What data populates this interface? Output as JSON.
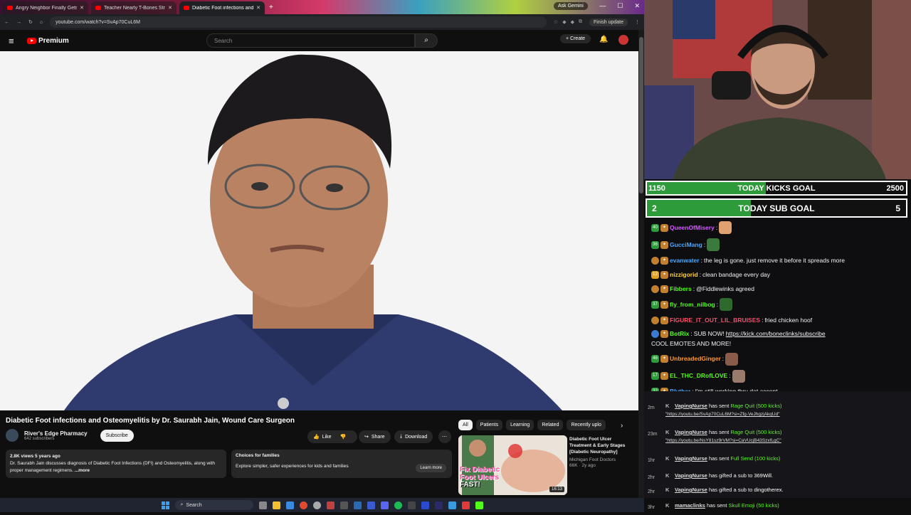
{
  "browser": {
    "tabs": [
      {
        "title": "Angry Neighbor Finally Gets W"
      },
      {
        "title": "Teacher Nearly T-Bones Strang"
      },
      {
        "title": "Diabetic Foot infections and"
      }
    ],
    "ask_gemini": "Ask Gemini",
    "url": "youtube.com/watch?v=SvAp70CuL6M",
    "finish_update": "Finish update"
  },
  "youtube": {
    "logo": "Premium",
    "search_placeholder": "Search",
    "create": "Create",
    "video_title": "Diabetic Foot infections and Osteomyelitis by Dr. Saurabh Jain, Wound Care Surgeon",
    "channel_name": "River's Edge Pharmacy",
    "subscribers": "642 subscribers",
    "subscribe": "Subscribe",
    "like": "Like",
    "share": "Share",
    "download": "Download",
    "desc_meta": "2.8K views  5 years ago",
    "desc_text": "Dr. Saurabh Jain discusses diagnosis of Diabetic Foot Infections (DFI) and Osteomyelitis, along with proper management regimens.",
    "desc_more": "...more",
    "choices_title": "Choices for families",
    "choices_text": "Explore simpler, safer experiences for kids and families",
    "learn_more": "Learn more",
    "chips": [
      "All",
      "Patients",
      "Learning",
      "Related",
      "Recently uplo"
    ],
    "rec": {
      "title": "Diabetic Foot Ulcer Treatment & Early Stages [Diabetic Neuropathy]",
      "channel": "Michigan Foot Doctors",
      "meta": "66K · 2y ago",
      "duration": "16:13",
      "thumb_text_1": "Fix Diabetic",
      "thumb_text_2": "Foot Ulcers",
      "thumb_text_3": "FAST!"
    }
  },
  "stream": {
    "kicks_goal": {
      "current": "1150",
      "label": "TODAY KICKS GOAL",
      "target": "2500",
      "progress": 0.46
    },
    "sub_goal": {
      "current": "2",
      "label": "TODAY SUB GOAL",
      "target": "5",
      "progress": 0.4
    },
    "chat": [
      {
        "badge": "40",
        "badge_color": "#2e9b3a",
        "user": "QueenOfMisery",
        "color": "#d45aff",
        "text": "",
        "emote": "#e0a070"
      },
      {
        "badge": "36",
        "badge_color": "#2e9b3a",
        "user": "GucciMang",
        "color": "#4aa8ff",
        "text": "",
        "emote": "#3a7a3a"
      },
      {
        "badge": "",
        "badge_color": "#c08030",
        "user": "evanwater",
        "color": "#4aa8ff",
        "text": "the leg is gone. just remove it before it spreads more",
        "emote": ""
      },
      {
        "badge": "12",
        "badge_color": "#e0a020",
        "user": "nizzigorid",
        "color": "#ffd030",
        "text": "clean bandage every day",
        "emote": ""
      },
      {
        "badge": "",
        "badge_color": "#c08030",
        "user": "Fibbers",
        "color": "#53fc18",
        "text": "@Fiddlewinks agreed",
        "emote": ""
      },
      {
        "badge": "37",
        "badge_color": "#2e9b3a",
        "user": "fly_from_nilbog",
        "color": "#53fc18",
        "text": "",
        "emote": "#2e6a2e"
      },
      {
        "badge": "",
        "badge_color": "#c08030",
        "user": "FIGURE_IT_OUT_LIL_BRUISES",
        "color": "#ff4a6a",
        "text": "fried chicken hoof",
        "emote": ""
      },
      {
        "badge": "",
        "badge_color": "#3a7ad0",
        "user": "BotRix",
        "color": "#53fc18",
        "text": "SUB NOW! ",
        "link": "https://kick.com/boneclinks/subscribe",
        "text2": " COOL EMOTES AND MORE!",
        "emote": ""
      },
      {
        "badge": "46",
        "badge_color": "#2e9b3a",
        "user": "UnbreadedGinger",
        "color": "#ff9a30",
        "text": "",
        "emote": "#8a5a4a"
      },
      {
        "badge": "17",
        "badge_color": "#2e9b3a",
        "user": "EL_THC_DRofLOVE",
        "color": "#53fc18",
        "text": "",
        "emote": "#9a7a6a"
      },
      {
        "badge": "32",
        "badge_color": "#2e9b3a",
        "user": "Blyther",
        "color": "#4aa8ff",
        "text": "I'm still working thru dat accent",
        "emote": ""
      }
    ],
    "alerts": [
      {
        "age": "2m",
        "user": "VapingNurse",
        "mid": "has sent",
        "item": "Rage Quit (500 kicks)",
        "sub": "\"https://youtu.be/SvAp70CuL6M?si=Zfg-VeJhgzjAkqUd\""
      },
      {
        "age": "23m",
        "user": "VapingNurse",
        "mid": "has sent",
        "item": "Rage Quit (500 kicks)",
        "sub": "\"https://youtu.be/NsY81sz9rVM?si=CaVUcjB43SzxfLgC\""
      },
      {
        "age": "1hr",
        "user": "VapingNurse",
        "mid": "has sent",
        "item": "Full Send (100 kicks)",
        "sub": ""
      },
      {
        "age": "2hr",
        "user": "VapingNurse",
        "mid": "has gifted a sub to",
        "item": "369Will.",
        "sub": ""
      },
      {
        "age": "2hr",
        "user": "VapingNurse",
        "mid": "has gifted a sub to",
        "item": "dingotherex.",
        "sub": ""
      },
      {
        "age": "3hr",
        "user": "mamaclinks",
        "mid": "has sent",
        "item": "Skull Emoji (50 kicks)",
        "sub": ""
      }
    ]
  },
  "taskbar": {
    "search": "Search"
  }
}
